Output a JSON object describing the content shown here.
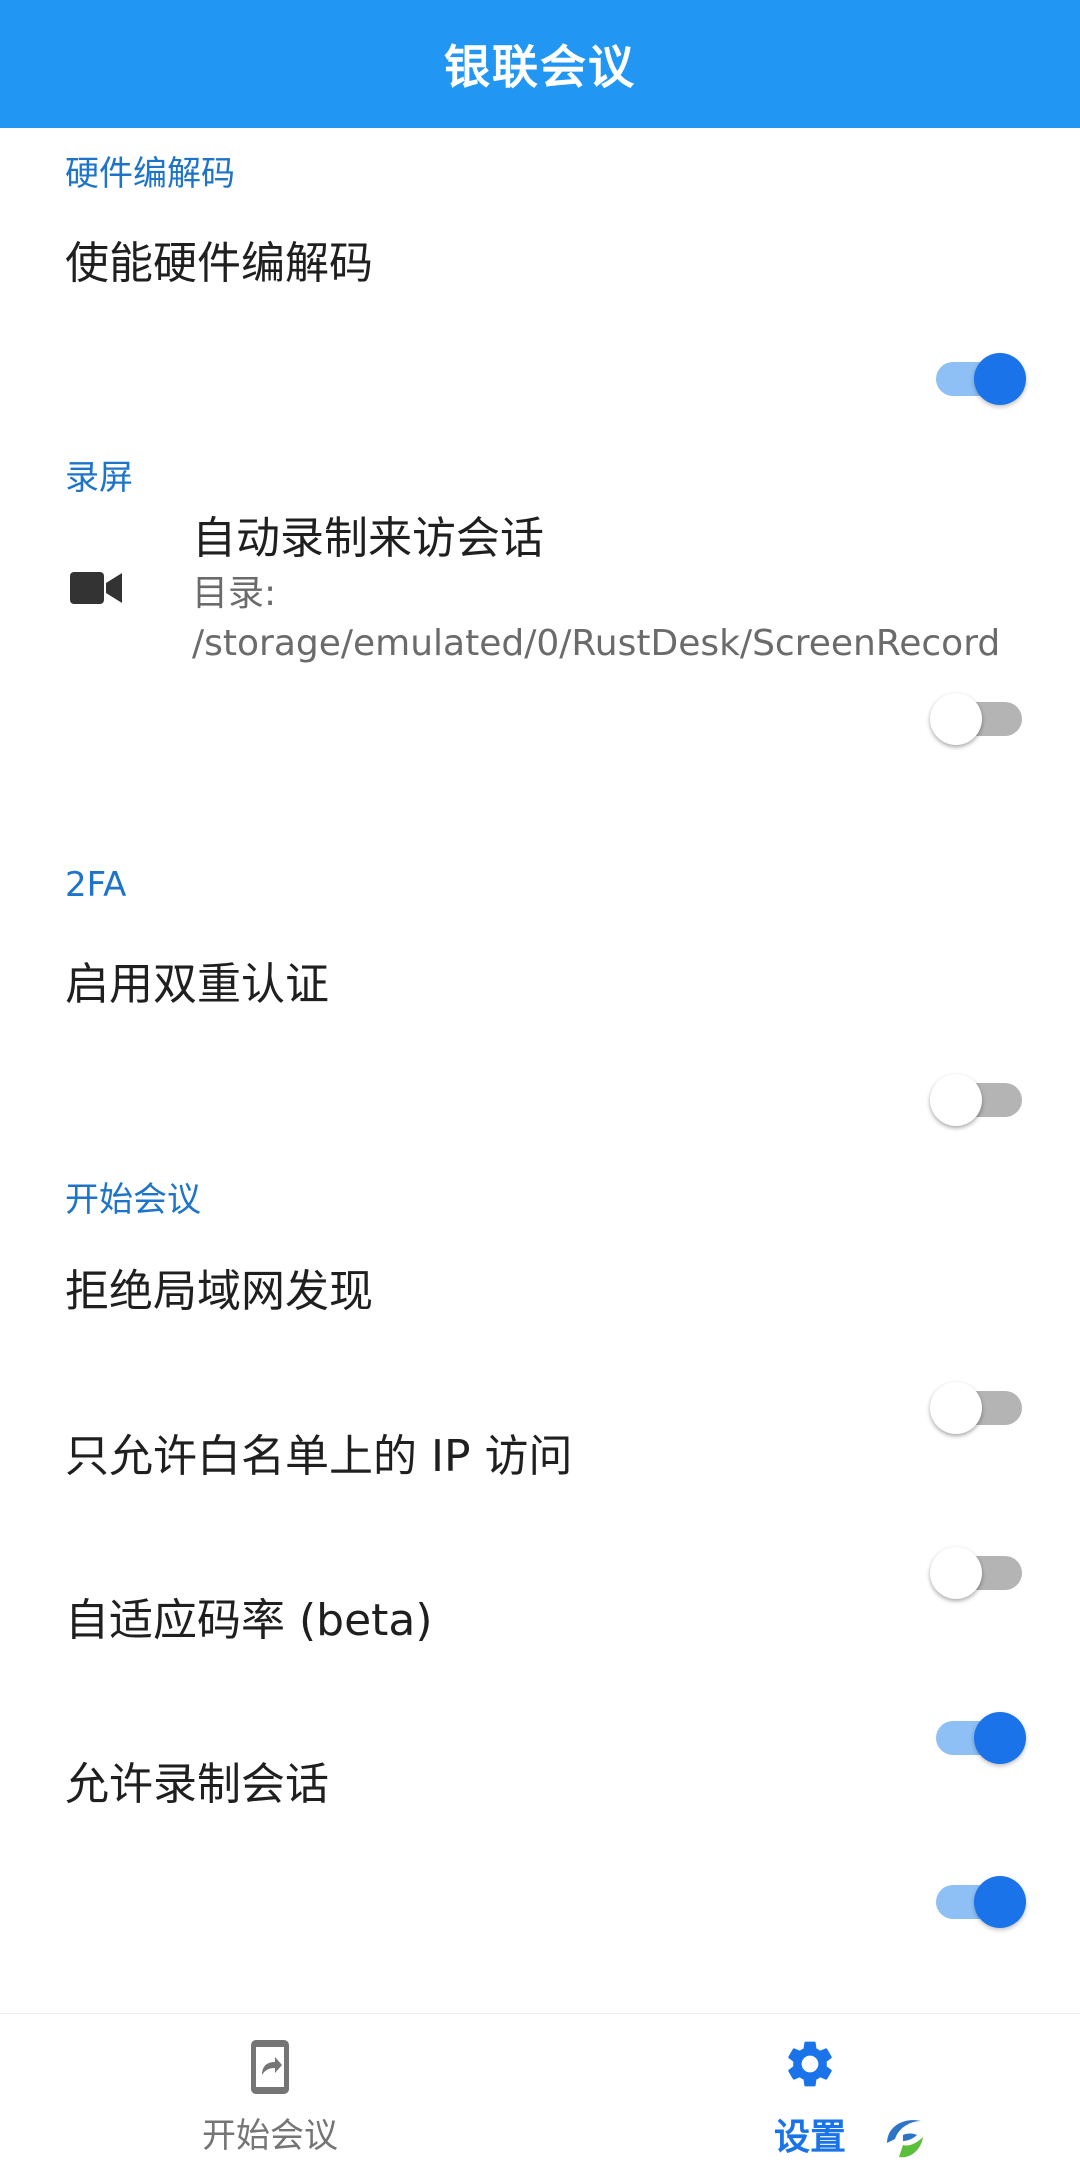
{
  "app_bar": {
    "title": "银联会议"
  },
  "sections": {
    "hardware_codec": {
      "header": "硬件编解码",
      "enable_hw_codec": {
        "label": "使能硬件编解码",
        "enabled": true
      }
    },
    "screen_recording": {
      "header": "录屏",
      "auto_record": {
        "icon": "videocam-icon",
        "label": "自动录制来访会话",
        "subtitle": "目录: /storage/emulated/0/RustDesk/ScreenRecord",
        "enabled": false
      }
    },
    "two_fa": {
      "header": "2FA",
      "enable_2fa": {
        "label": "启用双重认证",
        "enabled": false
      }
    },
    "start_meeting": {
      "header": "开始会议",
      "deny_lan_discovery": {
        "label": "拒绝局域网发现",
        "enabled": false
      },
      "whitelist_ip_only": {
        "label": "只允许白名单上的 IP 访问",
        "enabled": false
      },
      "adaptive_bitrate": {
        "label": "自适应码率 (beta)",
        "enabled": true
      },
      "allow_record_session": {
        "label": "允许录制会话",
        "enabled": true
      }
    }
  },
  "bottom_nav": {
    "items": [
      {
        "label": "开始会议",
        "icon": "share-screen-phone-icon",
        "active": false
      },
      {
        "label": "设置",
        "icon": "gear-icon",
        "active": true
      }
    ]
  },
  "colors": {
    "app_bar": "#2196f3",
    "section_header": "#1e74c9",
    "switch_on_thumb": "#1a73e8",
    "switch_on_track": "#8ec0f6",
    "switch_off_track": "#b4b4b4",
    "nav_active": "#1a73e8",
    "nav_inactive": "#757575"
  }
}
